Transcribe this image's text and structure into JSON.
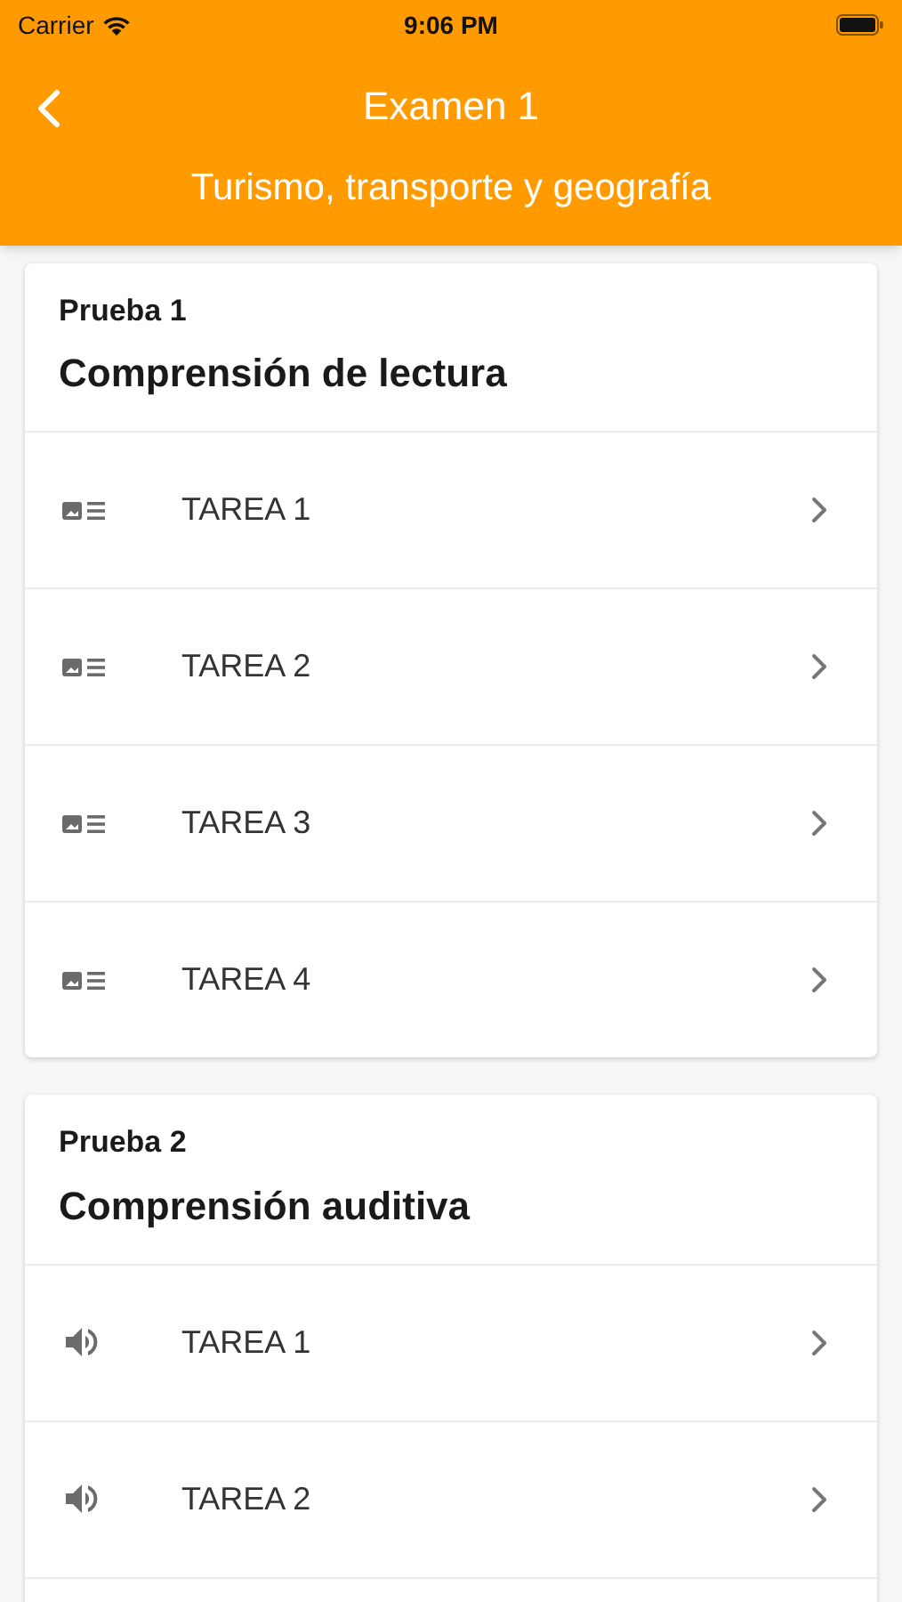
{
  "status_bar": {
    "carrier": "Carrier",
    "time": "9:06 PM"
  },
  "header": {
    "title": "Examen 1",
    "subtitle": "Turismo, transporte y geografía"
  },
  "sections": [
    {
      "label": "Prueba 1",
      "title": "Comprensión de lectura",
      "kind": "reading",
      "items": [
        "TAREA 1",
        "TAREA 2",
        "TAREA 3",
        "TAREA 4"
      ],
      "continues": false
    },
    {
      "label": "Prueba 2",
      "title": "Comprensión auditiva",
      "kind": "listening",
      "items": [
        "TAREA 1",
        "TAREA 2"
      ],
      "continues": true
    }
  ]
}
